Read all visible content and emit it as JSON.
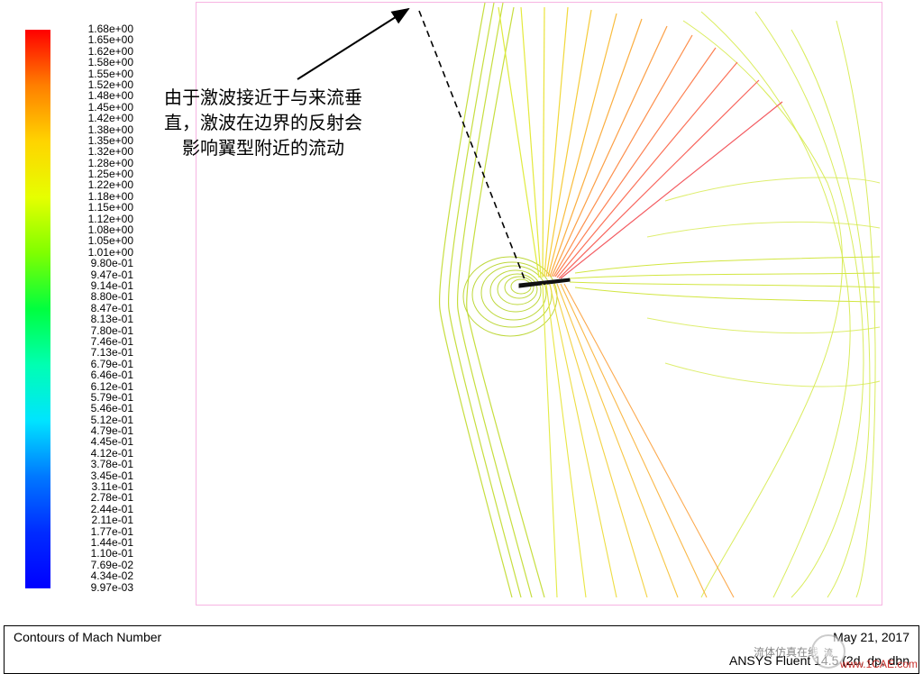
{
  "chart_data": {
    "type": "contour",
    "title": "Contours of Mach Number",
    "variable": "Mach Number",
    "color_scale": {
      "min": 0.00997,
      "max": 1.68,
      "ticks": [
        "1.68e+00",
        "1.65e+00",
        "1.62e+00",
        "1.58e+00",
        "1.55e+00",
        "1.52e+00",
        "1.48e+00",
        "1.45e+00",
        "1.42e+00",
        "1.38e+00",
        "1.35e+00",
        "1.32e+00",
        "1.28e+00",
        "1.25e+00",
        "1.22e+00",
        "1.18e+00",
        "1.15e+00",
        "1.12e+00",
        "1.08e+00",
        "1.05e+00",
        "1.01e+00",
        "9.80e-01",
        "9.47e-01",
        "9.14e-01",
        "8.80e-01",
        "8.47e-01",
        "8.13e-01",
        "7.80e-01",
        "7.46e-01",
        "7.13e-01",
        "6.79e-01",
        "6.46e-01",
        "6.12e-01",
        "5.79e-01",
        "5.46e-01",
        "5.12e-01",
        "4.79e-01",
        "4.45e-01",
        "4.12e-01",
        "3.78e-01",
        "3.45e-01",
        "3.11e-01",
        "2.78e-01",
        "2.44e-01",
        "2.11e-01",
        "1.77e-01",
        "1.44e-01",
        "1.10e-01",
        "7.69e-02",
        "4.34e-02",
        "9.97e-03"
      ],
      "gradient": [
        "#ff0000",
        "#ff7f00",
        "#ffd400",
        "#e6ff00",
        "#7fff00",
        "#00ff3f",
        "#00ffb2",
        "#00e4ff",
        "#0078ff",
        "#002bff",
        "#0000ff"
      ]
    },
    "annotation": {
      "text_lines": [
        "由于激波接近于与来流垂",
        "直，激波在边界的反射会",
        "影响翼型附近的流动"
      ]
    },
    "region": "2D airfoil external flow, near-normal shock around airfoil",
    "software": "ANSYS Fluent 14.5 (2d, dp, dbn…",
    "date": "May 21, 2017"
  },
  "footer": {
    "title": "Contours of Mach Number",
    "software": "ANSYS Fluent 14.5 (2d, dp, dbn",
    "date": "May 21, 2017"
  },
  "watermark": {
    "text": "流体仿真在线",
    "url": "www.1CAE.com"
  }
}
